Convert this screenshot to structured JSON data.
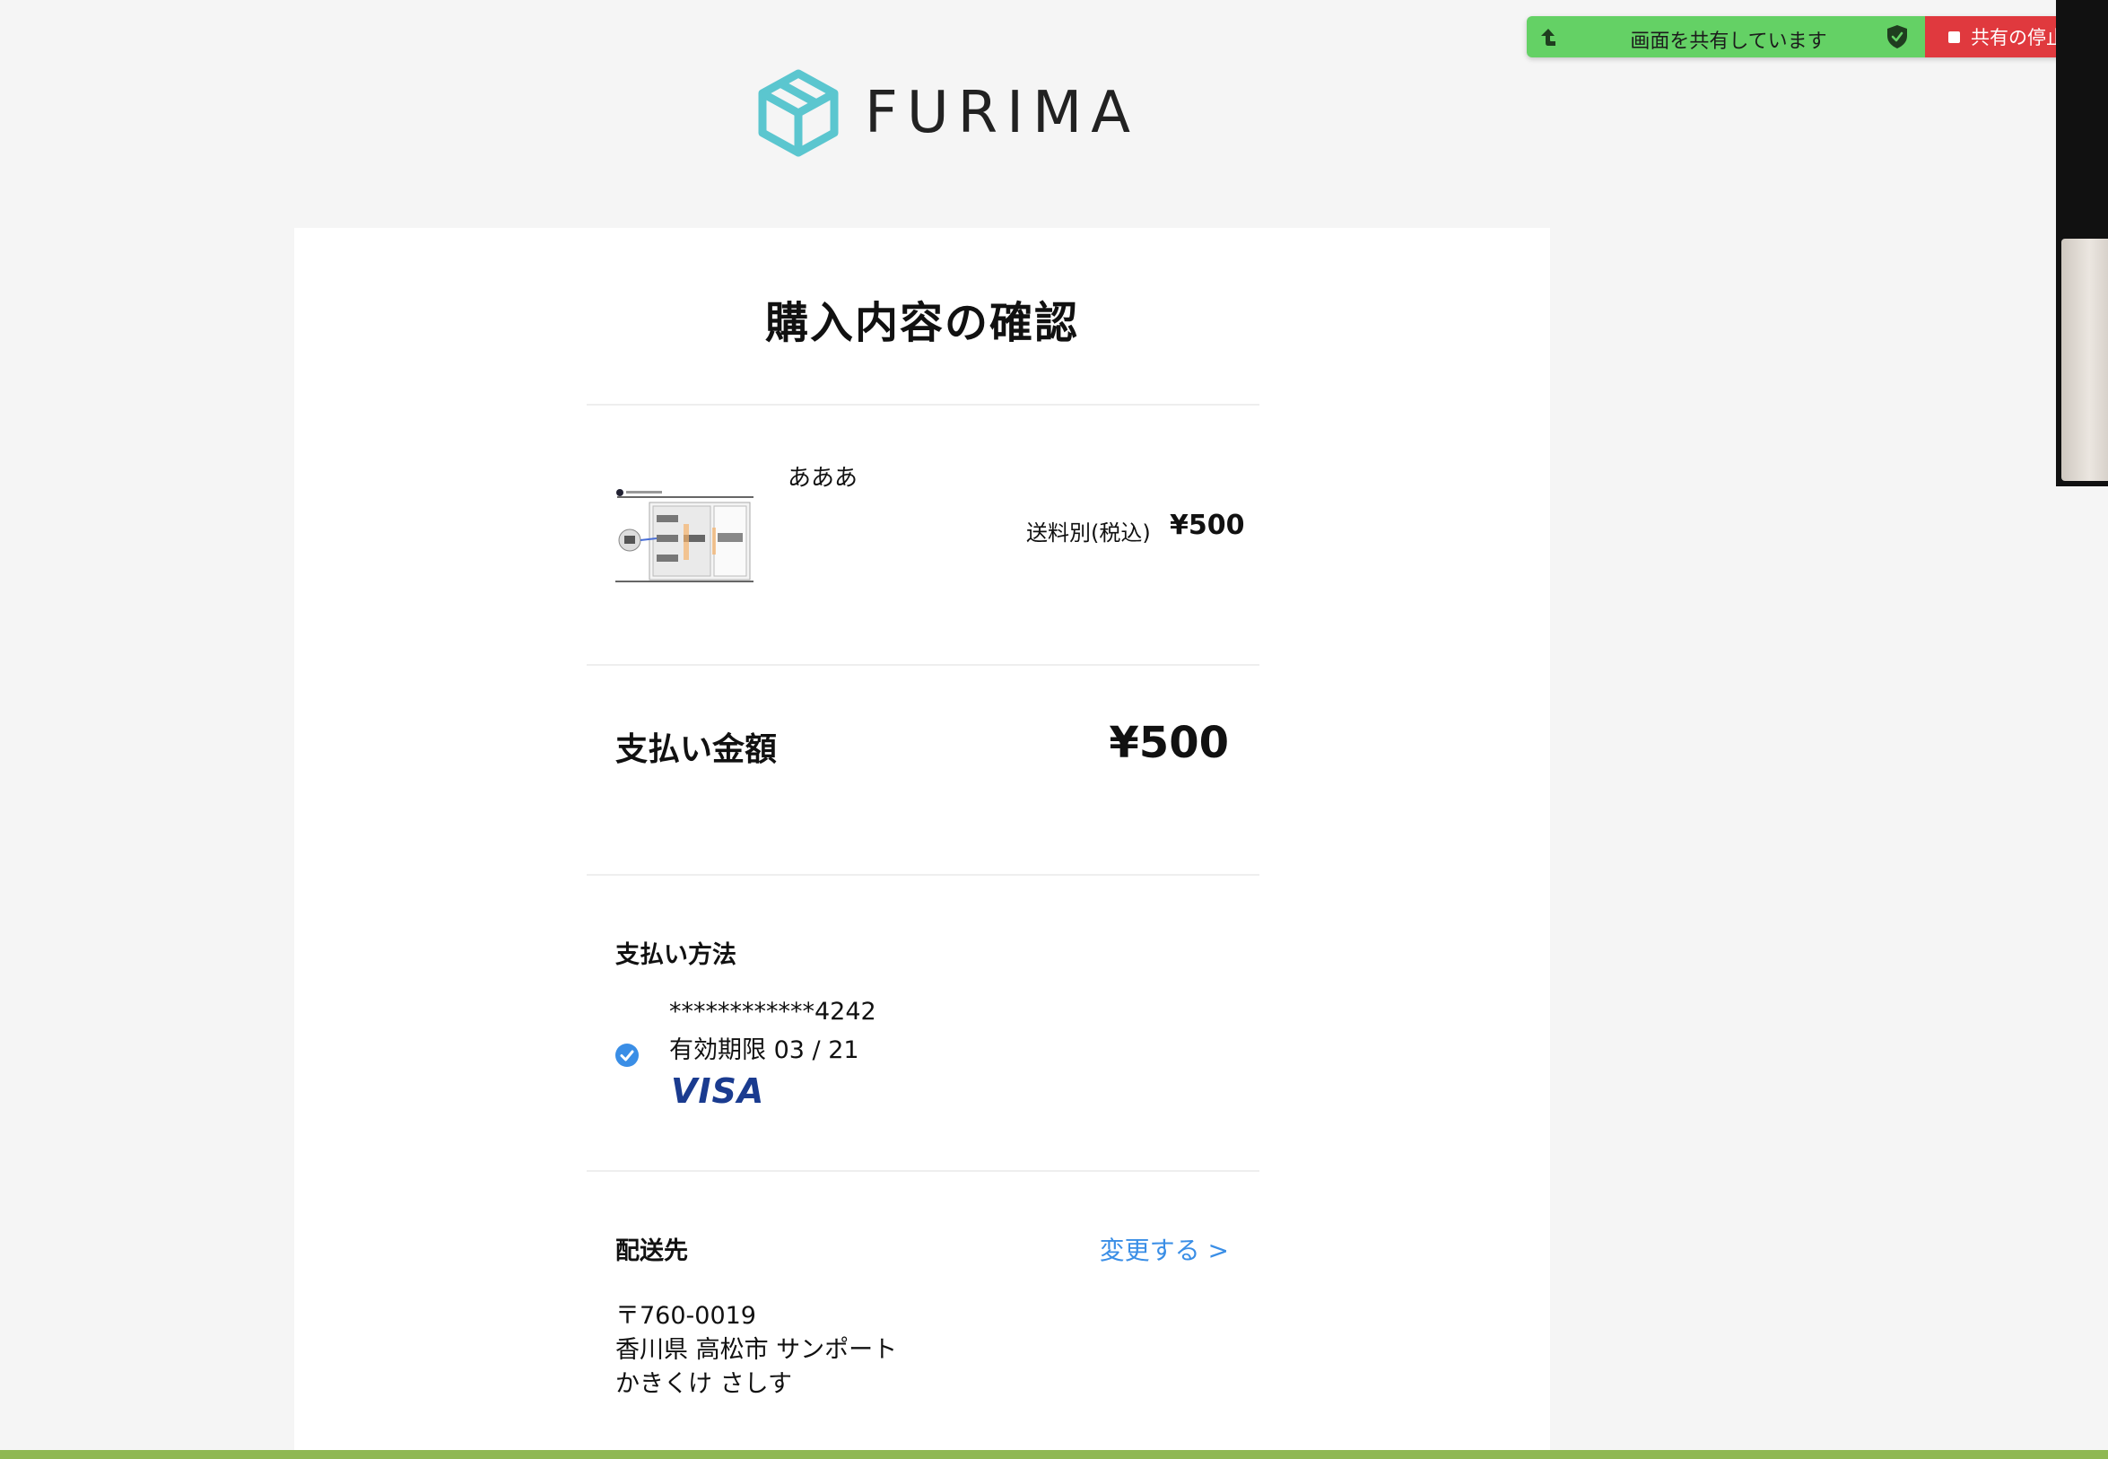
{
  "brand": {
    "name": "FURIMA",
    "accent": "#5bc6cf"
  },
  "page": {
    "title": "購入内容の確認"
  },
  "item": {
    "name": "あああ",
    "shipping_note": "送料別(税込)",
    "price": "¥500"
  },
  "total": {
    "label": "支払い金額",
    "value": "¥500"
  },
  "payment": {
    "label": "支払い方法",
    "card_number": "************4242",
    "expiry": "有効期限 03 / 21",
    "brand": "VISA",
    "selected_icon": "check-circle-icon"
  },
  "shipping": {
    "label": "配送先",
    "change_link": "変更する >",
    "postal_code": "〒760-0019",
    "address": "香川県 高松市 サンポート",
    "recipient": "かきくけ さしす"
  },
  "screen_share": {
    "status": "画面を共有しています",
    "stop_label": "共有の停止",
    "banner_color": "#64d165",
    "stop_color": "#e0393e"
  },
  "link_color": "#3a8ee6"
}
